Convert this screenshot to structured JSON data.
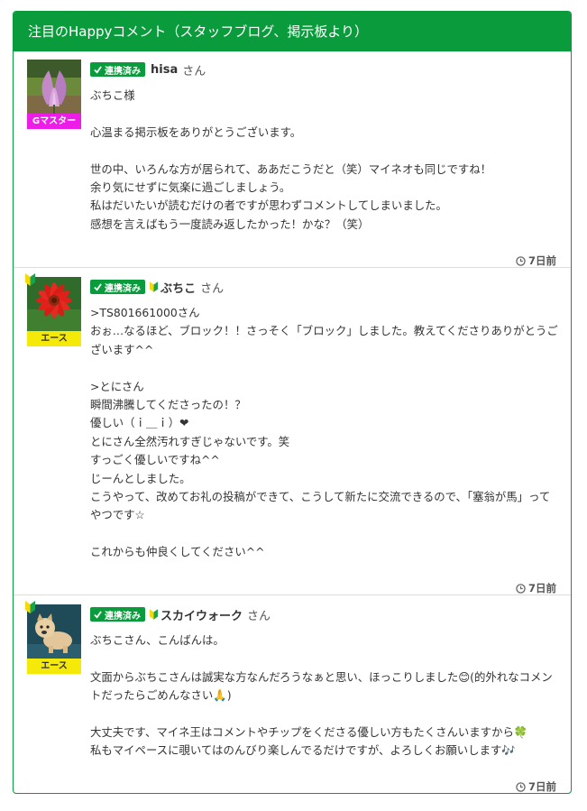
{
  "panel": {
    "title": "注目のHappyコメント（スタッフブログ、掲示板より）",
    "accent_color": "#0a9b3c"
  },
  "posts": [
    {
      "rank": "Gマスター",
      "rank_color": "#ee1ce8",
      "badge": "連携済み",
      "username": "hisa",
      "honorific": "さん",
      "beginner_mark": false,
      "body": "ぶちこ様\n\n心温まる掲示板をありがとうございます。\n\n世の中、いろんな方が居られて、ああだこうだと（笑）マイネオも同じですね！\n余り気にせずに気楽に過ごしましょう。\n私はだいたいが読むだけの者ですが思わずコメントしてしまいました。\n感想を言えばもう一度読み返したかった！かな？（笑）",
      "time": "7日前",
      "avatar_icon": "magnolia-flower-photo"
    },
    {
      "rank": "エース",
      "rank_color": "#f5e90a",
      "badge": "連携済み",
      "username": "ぶちこ",
      "honorific": "さん",
      "beginner_mark": true,
      "body": ">TS801661000さん\nおぉ…なるほど、ブロック！！さっそく「ブロック」しました。教えてくださりありがとうございます^^\n\n>とにさん\n瞬間沸騰してくださったの！？\n優しい（ｉ＿ｉ）❤\nとにさん全然汚れすぎじゃないです。笑\nすっごく優しいですね^^\nじーんとしました。\nこうやって、改めてお礼の投稿ができて、こうして新たに交流できるので、「塞翁が馬」ってやつです☆\n\nこれからも仲良くしてください^^",
      "time": "7日前",
      "avatar_icon": "red-gerbera-photo"
    },
    {
      "rank": "エース",
      "rank_color": "#f5e90a",
      "badge": "連携済み",
      "username": "スカイウォーク",
      "honorific": "さん",
      "beginner_mark": true,
      "body": "ぶちこさん、こんばんは。\n\n文面からぶちこさんは誠実な方なんだろうなぁと思い、ほっこりしました😊(的外れなコメントだったらごめんなさい🙏)\n\n大丈夫です、マイネ王はコメントやチップをくださる優しい方もたくさんいますから🍀\n私もマイペースに覗いてはのんびり楽しんでるだけですが、よろしくお願いします🎶",
      "time": "7日前",
      "avatar_icon": "dog-figurine-photo"
    }
  ]
}
